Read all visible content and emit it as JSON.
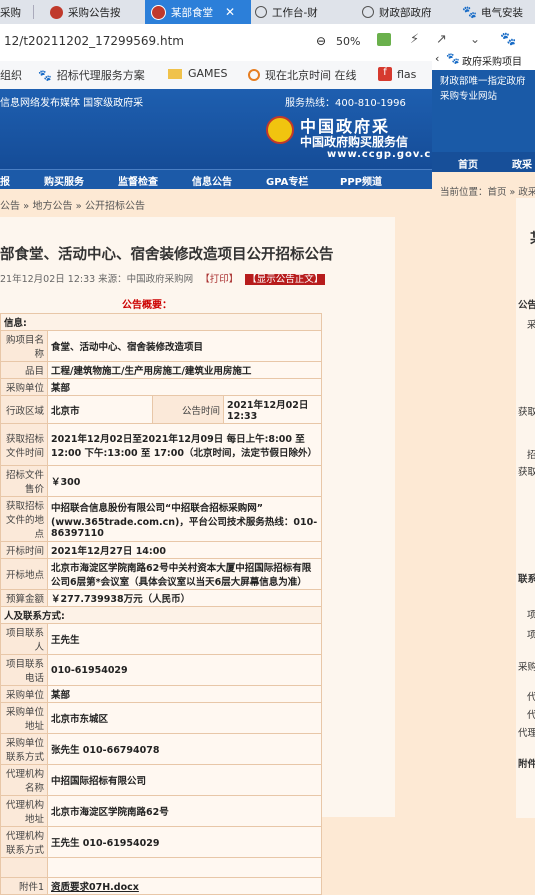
{
  "tabs": [
    {
      "label": "采购",
      "active": false
    },
    {
      "label": "采购公告按",
      "active": false
    },
    {
      "label": "某部食堂",
      "active": true
    },
    {
      "label": "工作台-财",
      "active": false
    },
    {
      "label": "财政部政府",
      "active": false
    },
    {
      "label": "电气安装",
      "active": false
    }
  ],
  "address": {
    "url": "12/t20211202_17299569.htm",
    "zoom": "50%"
  },
  "bookmarks": [
    {
      "label": "组织"
    },
    {
      "label": "招标代理服务方案"
    },
    {
      "label": "GAMES"
    },
    {
      "label": "现在北京时间 在线"
    },
    {
      "label": "flas"
    }
  ],
  "site": {
    "tagline": "信息网络发布媒体 国家级政府采",
    "hotline": "服务热线：400-810-1996",
    "logo_cn": "中国政府采",
    "logo_sub": "中国政府购买服务信",
    "logo_url": "www.ccgp.gov.c"
  },
  "nav": [
    "报",
    "购买服务",
    "监督检查",
    "信息公告",
    "GPA专栏",
    "PPP频道"
  ],
  "breadcrumb": "公告 » 地方公告 » 公开招标公告",
  "article": {
    "title": "部食堂、活动中心、宿舍装修改造项目公开招标公告",
    "meta_date": "21年12月02日 12:33 来源：中国政府采购网",
    "print": "【打印】",
    "show_text": "【显示公告正文】",
    "summary_label": "公告概要："
  },
  "info": {
    "sec_basic": "信息:",
    "sec_contact": "人及联系方式:",
    "rows": {
      "project_name": {
        "label": "购项目名称",
        "value": "食堂、活动中心、宿舍装修改造项目"
      },
      "category": {
        "label": "品目",
        "value": "工程/建筑物施工/生产用房施工/建筑业用房施工"
      },
      "purchaser": {
        "label": "采购单位",
        "value": "某部"
      },
      "region": {
        "label": "行政区域",
        "value": "北京市",
        "label2": "公告时间",
        "value2": "2021年12月02日 12:33"
      },
      "doc_time": {
        "label": "获取招标文件时间",
        "value": "2021年12月02日至2021年12月09日 每日上午:8:00 至 12:00  下午:13:00 至 17:00（北京时间，法定节假日除外）"
      },
      "doc_price": {
        "label": "招标文件售价",
        "value": "￥300"
      },
      "doc_place": {
        "label": "获取招标文件的地点",
        "value": "中招联合信息股份有限公司“中招联合招标采购网” (www.365trade.com.cn)，平台公司技术服务热线：010-86397110"
      },
      "open_time": {
        "label": "开标时间",
        "value": "2021年12月27日 14:00"
      },
      "open_place": {
        "label": "开标地点",
        "value": "北京市海淀区学院南路62号中关村资本大厦中招国际招标有限公司6层第*会议室（具体会议室以当天6层大屏幕信息为准）"
      },
      "budget": {
        "label": "预算金额",
        "value": "￥277.739938万元（人民币）"
      },
      "contact": {
        "label": "项目联系人",
        "value": "王先生"
      },
      "contact_phone": {
        "label": "项目联系电话",
        "value": "010-61954029"
      },
      "purchaser2": {
        "label": "采购单位",
        "value": "某部"
      },
      "purchaser_addr": {
        "label": "采购单位地址",
        "value": "北京市东城区"
      },
      "purchaser_contact": {
        "label": "采购单位联系方式",
        "value": "张先生 010-66794078"
      },
      "agency": {
        "label": "代理机构名称",
        "value": "中招国际招标有限公司"
      },
      "agency_addr": {
        "label": "代理机构地址",
        "value": "北京市海淀区学院南路62号"
      },
      "agency_contact": {
        "label": "代理机构联系方式",
        "value": "王先生 010-61954029"
      },
      "attachment": {
        "label": "附件1",
        "value": "资质要求07H.docx"
      }
    }
  },
  "right": {
    "tab_label": "政府采购项目",
    "site_desc": "财政部唯一指定政府采购专业网站",
    "nav1": "首页",
    "nav2": "政采",
    "crumb": "当前位置：首页 » 政采",
    "title_char": "某",
    "labels": [
      "公告",
      "采",
      "获取",
      "招",
      "获取",
      "联系",
      "项",
      "项",
      "采购",
      "代",
      "代",
      "代理",
      "附件"
    ]
  }
}
